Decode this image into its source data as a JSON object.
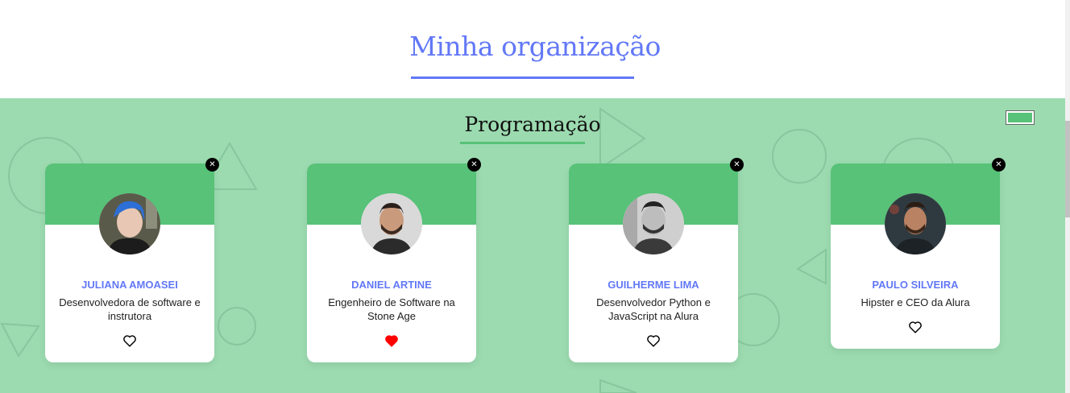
{
  "organization": {
    "title": "Minha organização"
  },
  "team": {
    "name": "Programação",
    "color": "#57c278",
    "secondary_color": "#9cdbb0",
    "members": [
      {
        "name": "JULIANA AMOASEI",
        "role": "Desenvolvedora de software e instrutora",
        "favorite": false
      },
      {
        "name": "DANIEL ARTINE",
        "role": "Engenheiro de Software na Stone Age",
        "favorite": true
      },
      {
        "name": "GUILHERME LIMA",
        "role": "Desenvolvedor Python e JavaScript na Alura",
        "favorite": false
      },
      {
        "name": "PAULO SILVEIRA",
        "role": "Hipster e CEO da Alura",
        "favorite": false
      }
    ]
  },
  "icons": {
    "close": "close-icon",
    "favorite": "heart-icon",
    "color_picker": "color-picker"
  },
  "accent_color": "#6278f7",
  "favorite_color": "#ff0000"
}
